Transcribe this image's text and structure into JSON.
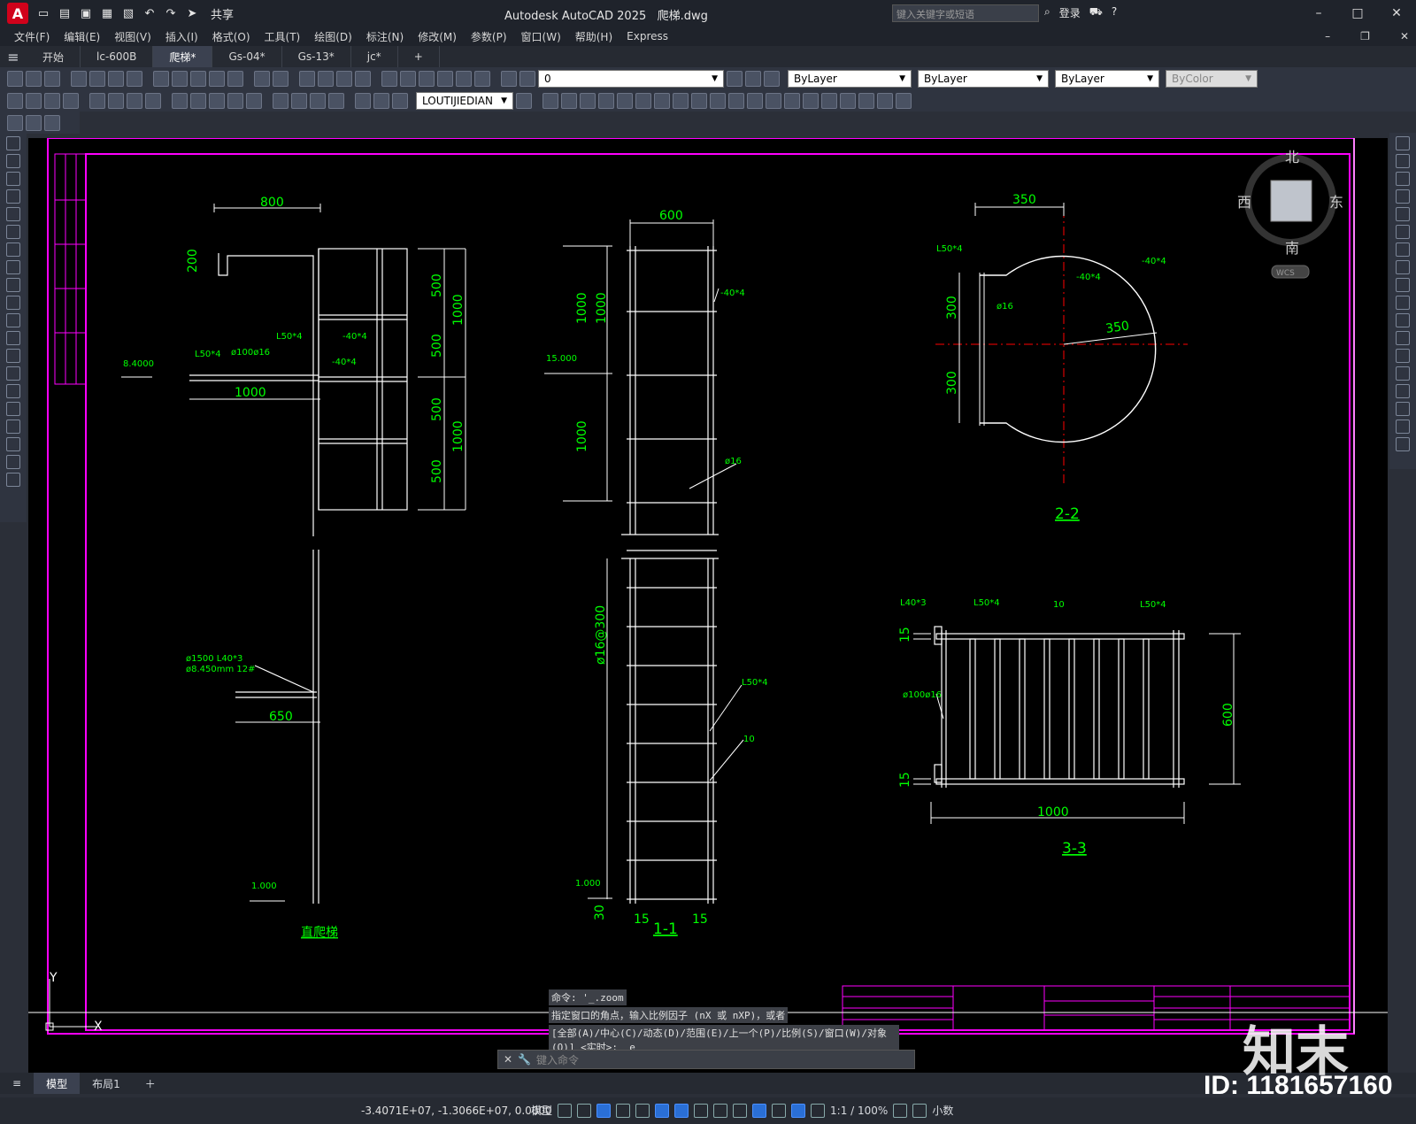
{
  "app": {
    "title": "Autodesk AutoCAD 2025",
    "filename": "爬梯.dwg",
    "logo": "A",
    "share": "共享"
  },
  "search": {
    "placeholder": "键入关键字或短语"
  },
  "user": {
    "login": "登录"
  },
  "menus": [
    "文件(F)",
    "编辑(E)",
    "视图(V)",
    "插入(I)",
    "格式(O)",
    "工具(T)",
    "绘图(D)",
    "标注(N)",
    "修改(M)",
    "参数(P)",
    "窗口(W)",
    "帮助(H)",
    "Express"
  ],
  "tabs": [
    "开始",
    "lc-600B",
    "爬梯*",
    "Gs-04*",
    "Gs-13*",
    "jc*"
  ],
  "active_tab": "爬梯*",
  "layer": {
    "value": "0"
  },
  "props": {
    "color": "ByLayer",
    "linetype": "ByLayer",
    "lineweight": "ByLayer",
    "plotstyle": "ByColor"
  },
  "dimstyle": "LOUTIJIEDIAN",
  "viewcube": {
    "n": "北",
    "s": "南",
    "e": "东",
    "w": "西",
    "wcs": "WCS"
  },
  "command": {
    "lines": [
      "命令: '_.zoom",
      "指定窗口的角点，输入比例因子 (nX 或 nXP)，或者",
      "[全部(A)/中心(C)/动态(D)/范围(E)/上一个(P)/比例(S)/窗口(W)/对象(O)] <实时>: _e"
    ],
    "placeholder": "键入命令"
  },
  "layouts": [
    "模型",
    "布局1"
  ],
  "status": {
    "coords": "-3.4071E+07, -1.3066E+07, 0.0000",
    "model": "模型",
    "scale": "1:1 / 100%",
    "units": "小数"
  },
  "watermark": {
    "id": "ID: 1181657160",
    "logo": "知末"
  },
  "drawing": {
    "elev_left": [
      "8.4000",
      "1.000"
    ],
    "elev_mid": [
      "15.000",
      "1.000"
    ],
    "dims_left": [
      "800",
      "200",
      "1000",
      "650",
      "500",
      "1000"
    ],
    "dims_mid": [
      "600",
      "1000",
      "1000",
      "1000",
      "ø16@300",
      "15",
      "15",
      "30"
    ],
    "labels_left": [
      "L50*4",
      "ø100ø16",
      "L50*4",
      "-40*4",
      "-40*4",
      "ø1500 L40*3",
      "ø8.450mm 12#",
      "直爬梯"
    ],
    "labels_mid": [
      "-40*4",
      "ø16",
      "L50*4",
      "10",
      "1-1"
    ],
    "sec22": [
      "350",
      "L50*4",
      "-40*4",
      "-40*4",
      "ø16",
      "300",
      "300",
      "350",
      "2-2"
    ],
    "sec33": [
      "L40*3",
      "L50*4",
      "10",
      "L50*4",
      "ø100ø16",
      "15",
      "15",
      "600",
      "1000",
      "3-3"
    ],
    "ucs": [
      "Y",
      "X"
    ]
  },
  "colors": {
    "green": "#00ff00",
    "white": "#ffffff",
    "magenta": "#ff00ff",
    "red": "#ff0000"
  }
}
